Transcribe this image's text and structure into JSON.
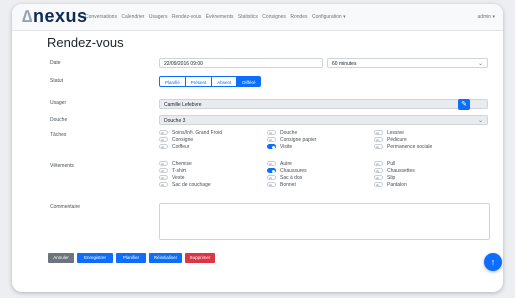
{
  "navbar": {
    "brand_mark": "∆",
    "brand": "nexus",
    "items": [
      "Conversations",
      "Calendrier",
      "Usagers",
      "Rendez-vous",
      "Évènements",
      "Statistics",
      "Consignes",
      "Rondes",
      "Configuration ▾"
    ],
    "user": "admin ▾"
  },
  "page": {
    "title": "Rendez-vous"
  },
  "form": {
    "date_label": "Date",
    "date_value": "22/09/2016 09:00",
    "duration_value": "60 minutes",
    "statut_label": "Statut",
    "statut_options": [
      "Planifié",
      "Présent",
      "Absent",
      "Différé"
    ],
    "statut_selected": "Différé",
    "usager_label": "Usager",
    "usager_value": "Camille Lefebvre",
    "douche_label": "Douche",
    "douche_value": "Douche 3",
    "taches_label": "Tâches",
    "taches": [
      {
        "label": "Soins/Infi. Grand Froid",
        "on": false
      },
      {
        "label": "Douche",
        "on": false
      },
      {
        "label": "Lessive",
        "on": false
      },
      {
        "label": "Consigne",
        "on": false
      },
      {
        "label": "Consigne papier",
        "on": false
      },
      {
        "label": "Pédicure",
        "on": false
      },
      {
        "label": "Coiffeur",
        "on": false
      },
      {
        "label": "Visite",
        "on": true
      },
      {
        "label": "Permanence sociale",
        "on": false
      }
    ],
    "vetements_label": "Vêtements",
    "vetements": [
      {
        "label": "Chemise",
        "on": false
      },
      {
        "label": "Autre",
        "on": false
      },
      {
        "label": "Pull",
        "on": false
      },
      {
        "label": "T-shirt",
        "on": false
      },
      {
        "label": "Chaussures",
        "on": true
      },
      {
        "label": "Chaussettes",
        "on": false
      },
      {
        "label": "Veste",
        "on": false
      },
      {
        "label": "Sac à dos",
        "on": false
      },
      {
        "label": "Slip",
        "on": false
      },
      {
        "label": "Sac de couchage",
        "on": false
      },
      {
        "label": "Bonnet",
        "on": false
      },
      {
        "label": "Pantalon",
        "on": false
      }
    ],
    "commentaire_label": "Commentaire"
  },
  "footer": {
    "buttons": [
      {
        "label": "Annuler",
        "color": "#6c757d"
      },
      {
        "label": "Enregistrer",
        "color": "#0d6efd"
      },
      {
        "label": "Planifier",
        "color": "#0d6efd"
      },
      {
        "label": "Réinitialiser",
        "color": "#0d6efd"
      },
      {
        "label": "Supprimer",
        "color": "#dc3545"
      }
    ]
  },
  "colors": {
    "primary": "#0d6efd",
    "danger": "#dc3545",
    "secondary": "#6c757d",
    "brand": "#0d2c55"
  }
}
